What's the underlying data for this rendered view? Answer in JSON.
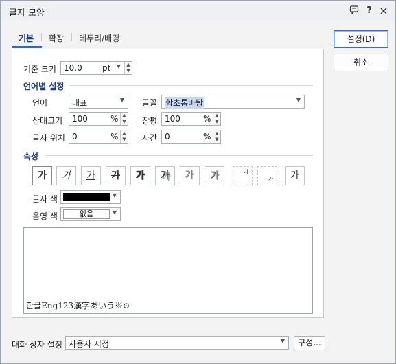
{
  "window": {
    "title": "글자 모양",
    "help_label": "?",
    "close_label": "×"
  },
  "tabs": [
    {
      "label": "기본"
    },
    {
      "label": "확장"
    },
    {
      "label": "테두리/배경"
    }
  ],
  "basic": {
    "size_label": "기준 크기",
    "size_value": "10.0",
    "size_unit": "pt"
  },
  "lang_section": {
    "title": "언어별 설정",
    "lang_label": "언어",
    "lang_value": "대표",
    "font_label": "글꼴",
    "font_value": "함초롬바탕",
    "rel_size_label": "상대크기",
    "rel_size_value": "100",
    "width_label": "장평",
    "width_value": "100",
    "position_label": "글자 위치",
    "position_value": "0",
    "spacing_label": "자간",
    "spacing_value": "0",
    "percent": "%"
  },
  "attr_section": {
    "title": "속성",
    "buttons": [
      "가",
      "가",
      "가",
      "가",
      "가",
      "가",
      "가",
      "가",
      "가",
      "가",
      "가"
    ],
    "text_color_label": "글자 색",
    "text_color": "#000000",
    "shade_color_label": "음영 색",
    "shade_color_value": "없음"
  },
  "preview": {
    "sample": "한글Eng123漢字あいう※⊙"
  },
  "buttons": {
    "ok": "설정(D)",
    "cancel": "취소",
    "compose": "구성..."
  },
  "footer": {
    "dialog_setting_label": "대화 상자 설정",
    "dialog_setting_value": "사용자 지정"
  }
}
